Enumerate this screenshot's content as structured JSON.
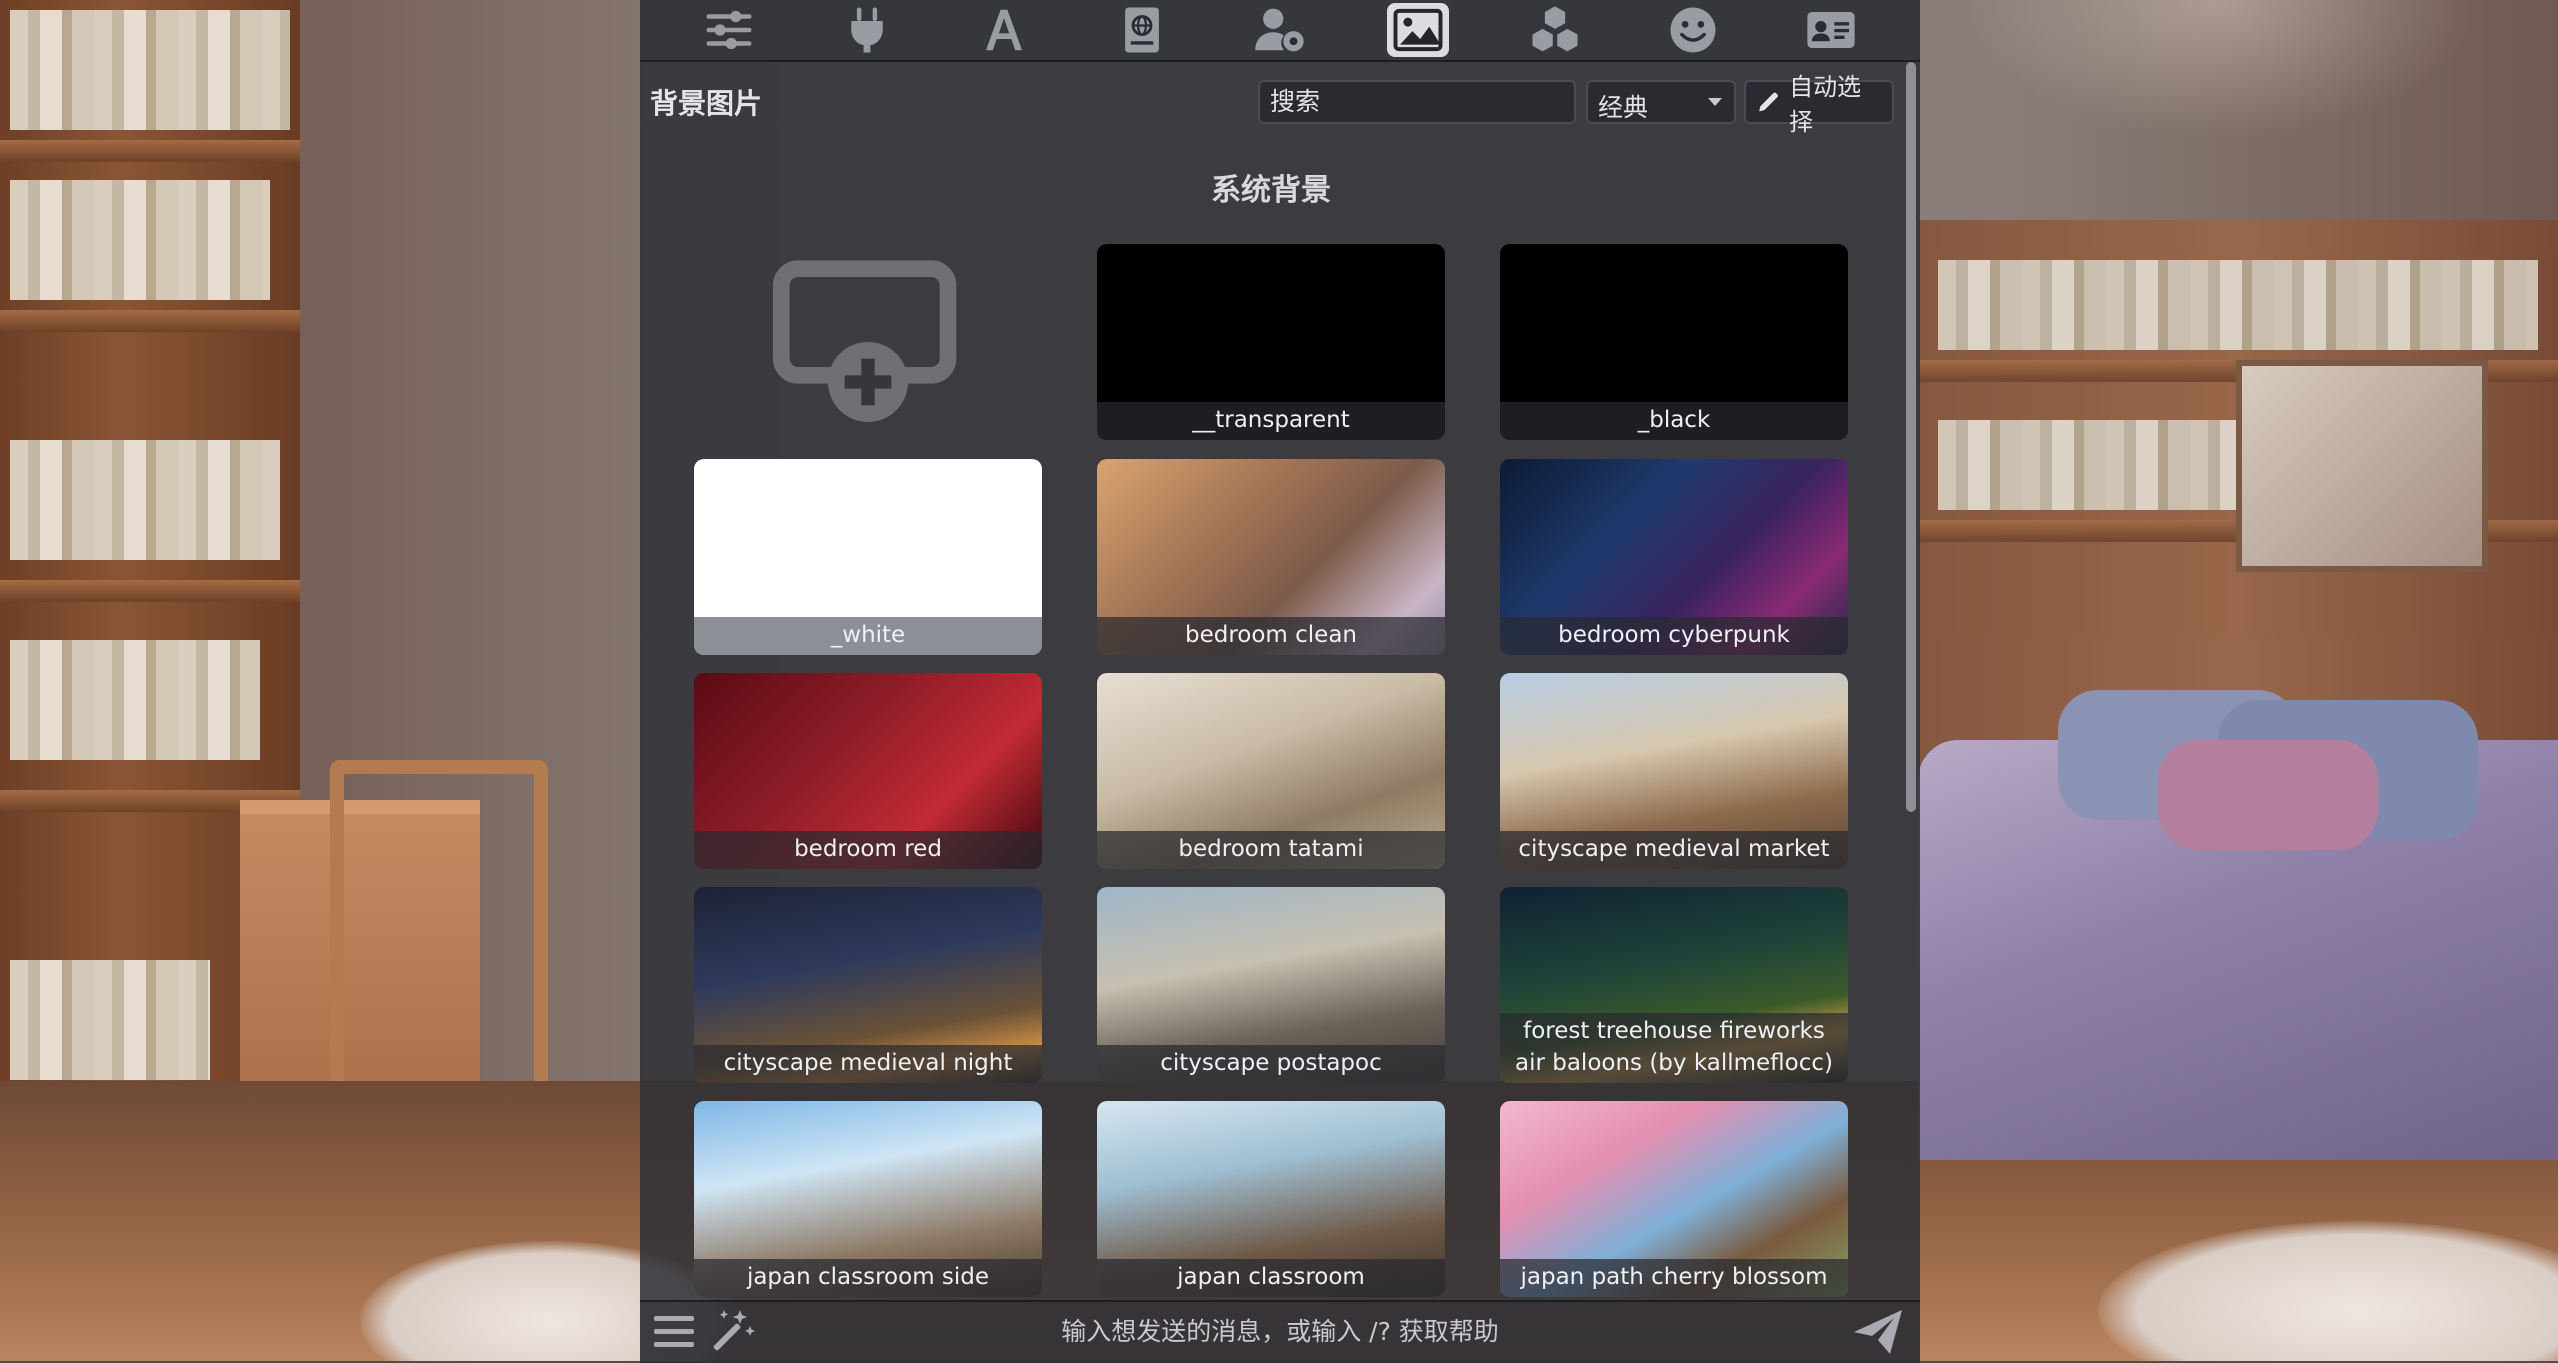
{
  "colors": {
    "panel_bg": "#2e3036",
    "text": "#e3e4e8",
    "active_tab_bg": "#dcdde2",
    "icon_gray": "#9a9ca4"
  },
  "topbar": {
    "icons": [
      {
        "name": "sliders-icon",
        "active": false
      },
      {
        "name": "plug-icon",
        "active": false
      },
      {
        "name": "text-a-icon",
        "active": false
      },
      {
        "name": "book-globe-icon",
        "active": false
      },
      {
        "name": "user-gear-icon",
        "active": false
      },
      {
        "name": "image-landscape-icon",
        "active": true
      },
      {
        "name": "cubes-icon",
        "active": false
      },
      {
        "name": "smiley-icon",
        "active": false
      },
      {
        "name": "id-card-icon",
        "active": false
      }
    ]
  },
  "panel": {
    "title": "背景图片",
    "search_placeholder": "搜索",
    "sort_selected": "经典",
    "auto_select_label": "自动选择",
    "section_title": "系统背景"
  },
  "backgrounds": [
    {
      "label": "__transparent",
      "bg": "bg-transparent"
    },
    {
      "label": "_black",
      "bg": "bg-black"
    },
    {
      "label": "_white",
      "bg": "bg-white"
    },
    {
      "label": "bedroom clean",
      "bg": "bg-bedroom-clean"
    },
    {
      "label": "bedroom cyberpunk",
      "bg": "bg-bedroom-cyberpunk"
    },
    {
      "label": "bedroom red",
      "bg": "bg-bedroom-red"
    },
    {
      "label": "bedroom tatami",
      "bg": "bg-bedroom-tatami"
    },
    {
      "label": "cityscape medieval market",
      "bg": "bg-cityscape-medieval-market"
    },
    {
      "label": "cityscape medieval night",
      "bg": "bg-cityscape-medieval-night"
    },
    {
      "label": "cityscape postapoc",
      "bg": "bg-cityscape-postapoc"
    },
    {
      "label": "forest treehouse fireworks air baloons (by kallmeflocc)",
      "bg": "bg-forest-treehouse"
    },
    {
      "label": "japan classroom side",
      "bg": "bg-japan-classroom-side"
    },
    {
      "label": "japan classroom",
      "bg": "bg-japan-classroom"
    },
    {
      "label": "japan path cherry blossom",
      "bg": "bg-japan-path-cherry"
    }
  ],
  "bottombar": {
    "message_placeholder": "输入想发送的消息，或输入 /? 获取帮助",
    "icons": [
      "menu-icon",
      "magic-wand-icon",
      "send-icon"
    ]
  }
}
